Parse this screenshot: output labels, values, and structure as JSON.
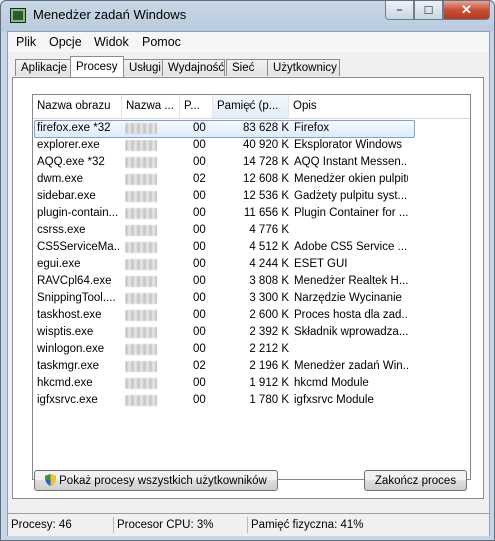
{
  "window": {
    "title": "Menedżer zadań Windows"
  },
  "menu": [
    "Plik",
    "Opcje",
    "Widok",
    "Pomoc"
  ],
  "tabs": [
    "Aplikacje",
    "Procesy",
    "Usługi",
    "Wydajność",
    "Sieć",
    "Użytkownicy"
  ],
  "active_tab": "Procesy",
  "columns": [
    "Nazwa obrazu",
    "Nazwa ...",
    "P...",
    "Pamięć (p...",
    "Opis"
  ],
  "processes": [
    {
      "name": "firefox.exe *32",
      "cpu": "00",
      "mem": "83 628 K",
      "desc": "Firefox"
    },
    {
      "name": "explorer.exe",
      "cpu": "00",
      "mem": "40 920 K",
      "desc": "Eksplorator Windows"
    },
    {
      "name": "AQQ.exe *32",
      "cpu": "00",
      "mem": "14 728 K",
      "desc": "AQQ Instant Messen..."
    },
    {
      "name": "dwm.exe",
      "cpu": "02",
      "mem": "12 608 K",
      "desc": "Menedżer okien pulpitu"
    },
    {
      "name": "sidebar.exe",
      "cpu": "00",
      "mem": "12 536 K",
      "desc": "Gadżety pulpitu syst..."
    },
    {
      "name": "plugin-contain...",
      "cpu": "00",
      "mem": "11 656 K",
      "desc": "Plugin Container for ..."
    },
    {
      "name": "csrss.exe",
      "cpu": "00",
      "mem": "4 776 K",
      "desc": ""
    },
    {
      "name": "CS5ServiceMa...",
      "cpu": "00",
      "mem": "4 512 K",
      "desc": "Adobe CS5 Service ..."
    },
    {
      "name": "egui.exe",
      "cpu": "00",
      "mem": "4 244 K",
      "desc": "ESET GUI"
    },
    {
      "name": "RAVCpl64.exe",
      "cpu": "00",
      "mem": "3 808 K",
      "desc": "Menedżer Realtek H..."
    },
    {
      "name": "SnippingTool....",
      "cpu": "00",
      "mem": "3 300 K",
      "desc": "Narzędzie Wycinanie"
    },
    {
      "name": "taskhost.exe",
      "cpu": "00",
      "mem": "2 600 K",
      "desc": "Proces hosta dla zad..."
    },
    {
      "name": "wisptis.exe",
      "cpu": "00",
      "mem": "2 392 K",
      "desc": "Składnik wprowadza..."
    },
    {
      "name": "winlogon.exe",
      "cpu": "00",
      "mem": "2 212 K",
      "desc": ""
    },
    {
      "name": "taskmgr.exe",
      "cpu": "02",
      "mem": "2 196 K",
      "desc": "Menedżer zadań Win..."
    },
    {
      "name": "hkcmd.exe",
      "cpu": "00",
      "mem": "1 912 K",
      "desc": "hkcmd Module"
    },
    {
      "name": "igfxsrvc.exe",
      "cpu": "00",
      "mem": "1 780 K",
      "desc": "igfxsrvc Module"
    }
  ],
  "buttons": {
    "show_all": "Pokaż procesy wszystkich użytkowników",
    "end_process": "Zakończ proces"
  },
  "status": {
    "processes": "Procesy: 46",
    "cpu": "Procesor CPU: 3%",
    "memory": "Pamięć fizyczna: 41%"
  }
}
